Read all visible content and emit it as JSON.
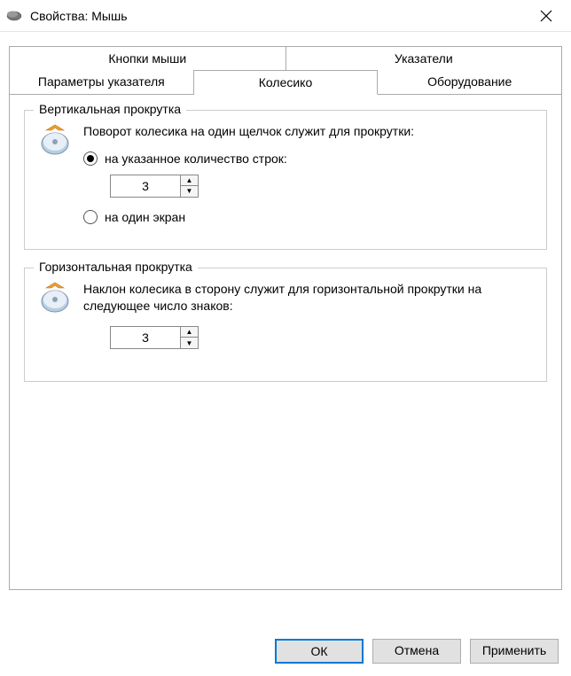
{
  "window": {
    "title": "Свойства: Мышь"
  },
  "tabs": {
    "row1": [
      "Кнопки мыши",
      "Указатели"
    ],
    "row2": [
      "Параметры указателя",
      "Колесико",
      "Оборудование"
    ],
    "active": "Колесико"
  },
  "vertical_group": {
    "title": "Вертикальная прокрутка",
    "desc": "Поворот колесика на один щелчок служит для прокрутки:",
    "radio_lines": "на указанное количество строк:",
    "radio_screen": "на один экран",
    "value": "3"
  },
  "horizontal_group": {
    "title": "Горизонтальная прокрутка",
    "desc": "Наклон колесика в сторону служит для горизонтальной прокрутки на следующее число знаков:",
    "value": "3"
  },
  "buttons": {
    "ok": "ОК",
    "cancel": "Отмена",
    "apply": "Применить"
  }
}
